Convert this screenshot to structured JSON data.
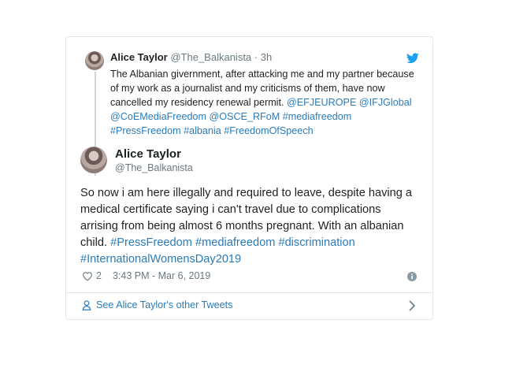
{
  "quoted_tweet": {
    "name": "Alice Taylor",
    "handle": "@The_Balkanista",
    "separator": "·",
    "time": "3h",
    "text_plain": "The Albanian givernment, after attacking me and my partner because of my work as a journalist and my criticisms of them, have now cancelled my residency renewal permit. ",
    "tags": "@EFJEUROPE @IFJGlobal @CoEMediaFreedom @OSCE_RFoM #mediafreedom #PressFreedom #albania #FreedomOfSpeech"
  },
  "tweet": {
    "name": "Alice Taylor",
    "handle": "@The_Balkanista",
    "text_plain": "So now i am here illegally and required to leave, despite having a medical certificate saying i can't travel due to complications arrising from being almost 6 months pregnant. With an albanian child. ",
    "tags": "#PressFreedom #mediafreedom #discrimination #InternationalWomensDay2019",
    "likes": "2",
    "timestamp": "3:43 PM - Mar 6, 2019"
  },
  "footer": {
    "label": "See Alice Taylor's other Tweets"
  },
  "icons": {
    "brand": "twitter-icon",
    "like": "heart-icon",
    "info": "info-icon",
    "profile": "person-icon",
    "more": "chevron-right-icon"
  },
  "colors": {
    "link": "#2b7bb9",
    "muted": "#697882",
    "text": "#1c2022",
    "twitter_blue": "#1da1f2"
  }
}
